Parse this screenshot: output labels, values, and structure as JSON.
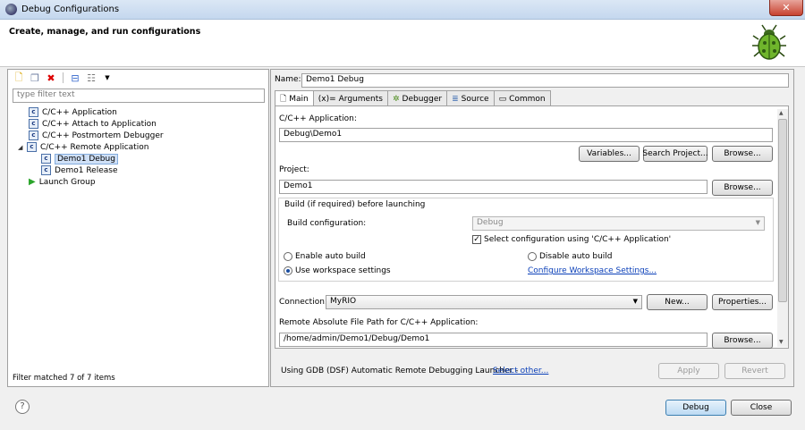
{
  "window": {
    "title": "Debug Configurations",
    "banner_title": "Create, manage, and run configurations",
    "close_symbol": "✕"
  },
  "left": {
    "toolbar_icons": [
      "new-configuration-icon",
      "duplicate-icon",
      "delete-icon",
      "collapse-all-icon",
      "filter-icon",
      "dropdown-arrow-icon"
    ],
    "filter_placeholder": "type filter text",
    "tree": [
      {
        "label": "C/C++ Application",
        "icon": "c-icon",
        "level": 0
      },
      {
        "label": "C/C++ Attach to Application",
        "icon": "c-icon",
        "level": 0
      },
      {
        "label": "C/C++ Postmortem Debugger",
        "icon": "c-icon",
        "level": 0
      },
      {
        "label": "C/C++ Remote Application",
        "icon": "c-icon",
        "level": 0,
        "expanded": true
      },
      {
        "label": "Demo1 Debug",
        "icon": "c-icon",
        "level": 1,
        "selected": true
      },
      {
        "label": "Demo1 Release",
        "icon": "c-icon",
        "level": 1
      },
      {
        "label": "Launch Group",
        "icon": "launch-group-icon",
        "level": 0
      }
    ],
    "status": "Filter matched 7 of 7 items"
  },
  "right": {
    "name_label": "Name:",
    "name_value": "Demo1 Debug",
    "tabs": [
      {
        "label": "Main",
        "icon": "main-tab-icon",
        "active": true
      },
      {
        "label": "Arguments",
        "icon": "arguments-icon"
      },
      {
        "label": "Debugger",
        "icon": "debugger-icon"
      },
      {
        "label": "Source",
        "icon": "source-icon"
      },
      {
        "label": "Common",
        "icon": "common-icon"
      }
    ],
    "main": {
      "app_label": "C/C++ Application:",
      "app_value": "Debug\\Demo1",
      "variables_btn": "Variables...",
      "search_project_btn": "Search Project...",
      "browse_btn": "Browse...",
      "project_label": "Project:",
      "project_value": "Demo1",
      "project_browse_btn": "Browse...",
      "build_group_label": "Build (if required) before launching",
      "build_config_label": "Build configuration:",
      "build_config_value": "Debug",
      "select_config_label": "Select configuration using 'C/C++ Application'",
      "select_config_checked": true,
      "enable_auto_build": "Enable auto build",
      "disable_auto_build": "Disable auto build",
      "use_workspace_settings": "Use workspace settings",
      "configure_workspace_link": "Configure Workspace Settings...",
      "connection_label": "Connection:",
      "connection_value": "MyRIO",
      "new_btn": "New...",
      "properties_btn": "Properties...",
      "remote_path_label": "Remote Absolute File Path for C/C++ Application:",
      "remote_path_value": "/home/admin/Demo1/Debug/Demo1",
      "remote_browse_btn": "Browse..."
    },
    "launcher_text": "Using GDB (DSF) Automatic Remote Debugging Launcher -",
    "select_other_link": "Select other...",
    "apply_btn": "Apply",
    "revert_btn": "Revert"
  },
  "footer": {
    "help_symbol": "?",
    "debug_btn": "Debug",
    "close_btn": "Close"
  }
}
